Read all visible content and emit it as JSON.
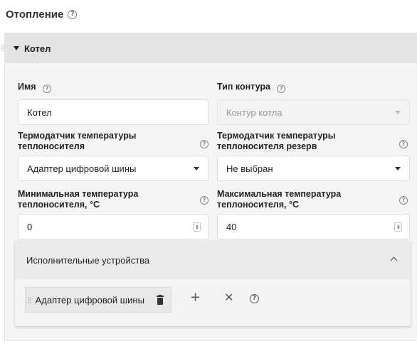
{
  "page": {
    "title": "Отопление",
    "title_help": "?"
  },
  "card": {
    "title": "Котел",
    "fields": {
      "name": {
        "label": "Имя",
        "value": "Котел",
        "help": "?"
      },
      "circuit_type": {
        "label": "Тип контура",
        "value": "Контур котла",
        "help": "?",
        "disabled": true
      },
      "sensor": {
        "label_line1": "Термодатчик температуры",
        "label_line2": "теплоносителя",
        "value": "Адаптер цифровой шины",
        "help": "?"
      },
      "sensor_reserve": {
        "label_line1": "Термодатчик температуры",
        "label_line2": "теплоносителя резерв",
        "value": "Не выбран",
        "help": "?"
      },
      "min_temp": {
        "label_line1": "Минимальная температура",
        "label_line2": "теплоносителя, °C",
        "value": "0",
        "help": "?"
      },
      "max_temp": {
        "label_line1": "Максимальная температура",
        "label_line2": "теплоносителя, °C",
        "value": "40",
        "help": "?"
      }
    }
  },
  "actuators": {
    "title": "Исполнительные устройства",
    "items": [
      {
        "label": "Адаптер цифровой шины"
      }
    ],
    "actions": {
      "add": "+",
      "clear": "✕",
      "help": "?"
    }
  },
  "icons": {
    "help": "help-circle-icon",
    "expand": "caret-down-icon",
    "collapse": "chevron-up-icon",
    "delete": "trash-icon",
    "drag": "drag-handle-icon"
  },
  "colors": {
    "header_bg": "#e3e3e3",
    "panel_bg": "#f5f5f5",
    "disabled_text": "#9a9a9a"
  }
}
